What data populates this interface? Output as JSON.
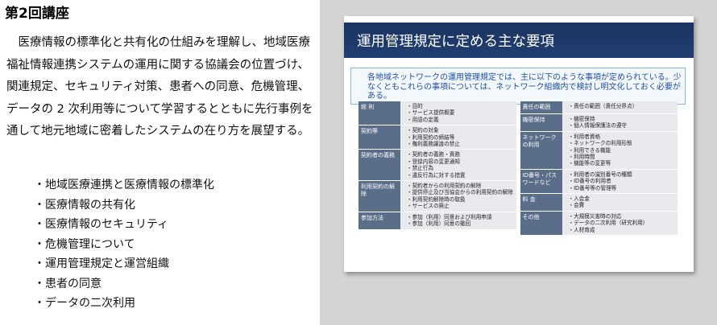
{
  "left": {
    "title": "第2回講座",
    "paragraph": "医療情報の標準化と共有化の仕組みを理解し、地域医療福祉情報連携システムの運用に関する協議会の位置づけ、関連規定、セキュリティ対策、患者への同意、危機管理、データの 2 次利用等について学習するとともに先行事例を通して地元地域に密着したシステムの在り方を展望する。",
    "bullets": [
      "地域医療連携と医療情報の標準化",
      "医療情報の共有化",
      "医療情報のセキュリティ",
      "危機管理について",
      "運用管理規定と運営組織",
      "患者の同意",
      "データの二次利用"
    ]
  },
  "slide": {
    "title": "運用管理規定に定める主な要項",
    "intro": "各地域ネットワークの運用管理規定では、主に以下のような事項が定められている。少なくともこれらの事項については、ネットワーク組織内で検討し明文化しておく必要がある。",
    "left_rows": [
      {
        "cat": "総 則",
        "items": [
          "目的",
          "サービス提供概要",
          "用語の定義"
        ]
      },
      {
        "cat": "契約等",
        "items": [
          "契約の対象",
          "利用契約の締結等",
          "権利義務譲渡の禁止"
        ]
      },
      {
        "cat": "契約者の義務",
        "items": [
          "契約者の義務・責務",
          "登録内容の変更通知",
          "禁止行為",
          "違反行為に対する措置"
        ]
      },
      {
        "cat": "利用契約の解除",
        "items": [
          "契約者からの利用契約の解除",
          "提供停止及び当協会からの利用契約の解除",
          "利用契約解除時の取扱",
          "サービスの廃止"
        ]
      },
      {
        "cat": "参加方法",
        "items": [
          "参加（利用）同意および利用申請",
          "参加（利用）同意の撤回"
        ]
      }
    ],
    "right_rows": [
      {
        "cat": "責任の範囲",
        "items": [
          "責任の範囲（責任分界点）"
        ]
      },
      {
        "cat": "機密保持",
        "items": [
          "機密保持",
          "個人情報保護法の遵守"
        ]
      },
      {
        "cat": "ネットワークの利用",
        "items": [
          "利用者資格",
          "ネットワークの利用形態",
          "利用できる機能",
          "利用時間",
          "機能等の変更等"
        ]
      },
      {
        "cat": "ID番号・パスワードなど",
        "items": [
          "利用者の識別番号の種類",
          "ID番号の利用者",
          "ID番号等の管理等"
        ]
      },
      {
        "cat": "料 金",
        "items": [
          "入会金",
          "会費"
        ]
      },
      {
        "cat": "その他",
        "items": [
          "大規模災害時の対応",
          "データの二次利用（研究利用）",
          "人材育成"
        ]
      }
    ]
  }
}
